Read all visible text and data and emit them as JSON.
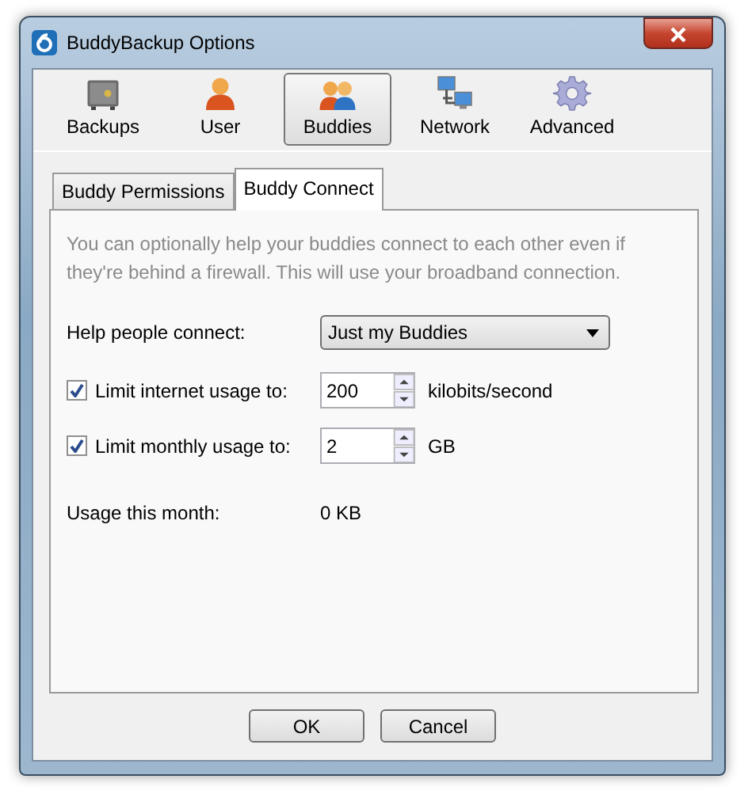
{
  "window": {
    "title": "BuddyBackup Options"
  },
  "toolbar": [
    {
      "label": "Backups",
      "kind": "safe",
      "selected": false
    },
    {
      "label": "User",
      "kind": "person",
      "selected": false
    },
    {
      "label": "Buddies",
      "kind": "people",
      "selected": true
    },
    {
      "label": "Network",
      "kind": "network",
      "selected": false
    },
    {
      "label": "Advanced",
      "kind": "gear",
      "selected": false
    }
  ],
  "tabs": [
    {
      "label": "Buddy Permissions",
      "selected": false
    },
    {
      "label": "Buddy Connect",
      "selected": true
    }
  ],
  "description": "You can optionally help your buddies connect to each other even if they're behind a firewall. This will use your broadband connection.",
  "connect": {
    "label": "Help people connect:",
    "value": "Just my Buddies"
  },
  "limits": [
    {
      "label": "Limit internet usage to:",
      "checked": true,
      "value": "200",
      "unit": "kilobits/second"
    },
    {
      "label": "Limit monthly usage to:",
      "checked": true,
      "value": "2",
      "unit": "GB"
    }
  ],
  "usage": {
    "label": "Usage this month:",
    "value": "0 KB"
  },
  "buttons": [
    "OK",
    "Cancel"
  ]
}
